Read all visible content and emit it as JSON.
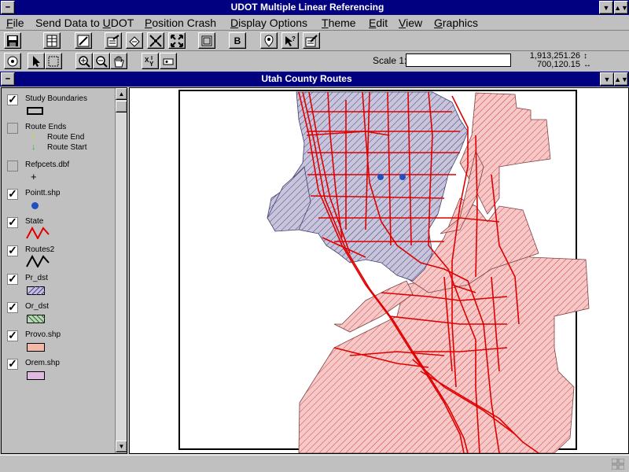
{
  "window": {
    "title": "UDOT Multiple Linear Referencing"
  },
  "menu": [
    {
      "label": "File",
      "u": "F",
      "rest": "ile"
    },
    {
      "label": "Send Data to UDOT",
      "pre": "Send Data to ",
      "u": "U",
      "rest": "DOT"
    },
    {
      "label": "Position Crash",
      "u": "P",
      "rest": "osition Crash"
    },
    {
      "label": "Display Options",
      "u": "D",
      "rest": "isplay Options"
    },
    {
      "label": "Theme",
      "u": "T",
      "rest": "heme"
    },
    {
      "label": "Edit",
      "u": "E",
      "rest": "dit"
    },
    {
      "label": "View",
      "u": "V",
      "rest": "iew"
    },
    {
      "label": "Graphics",
      "u": "G",
      "rest": "raphics"
    }
  ],
  "toolbar": {
    "b_label": "B"
  },
  "scale": {
    "label": "Scale 1:",
    "value": ""
  },
  "coords": {
    "x": "1,913,251.26",
    "y": "700,120.15"
  },
  "view": {
    "title": "Utah County Routes"
  },
  "legend": [
    {
      "name": "Study Boundaries",
      "checked": true
    },
    {
      "name": "Route Ends",
      "checked": false,
      "items": [
        "Route End",
        "Route Start"
      ]
    },
    {
      "name": "Refpcets.dbf",
      "checked": false
    },
    {
      "name": "Pointt.shp",
      "checked": true
    },
    {
      "name": "State",
      "checked": true
    },
    {
      "name": "Routes2",
      "checked": true
    },
    {
      "name": "Pr_dst",
      "checked": true
    },
    {
      "name": "Or_dst",
      "checked": true
    },
    {
      "name": "Provo.shp",
      "checked": true
    },
    {
      "name": "Orem.shp",
      "checked": true
    }
  ],
  "colors": {
    "titlebar": "#000080",
    "state_route": "#e00000",
    "provo_fill": "#f4b8b8",
    "orem_fill": "#d8c8dc",
    "point": "#2050c0"
  }
}
